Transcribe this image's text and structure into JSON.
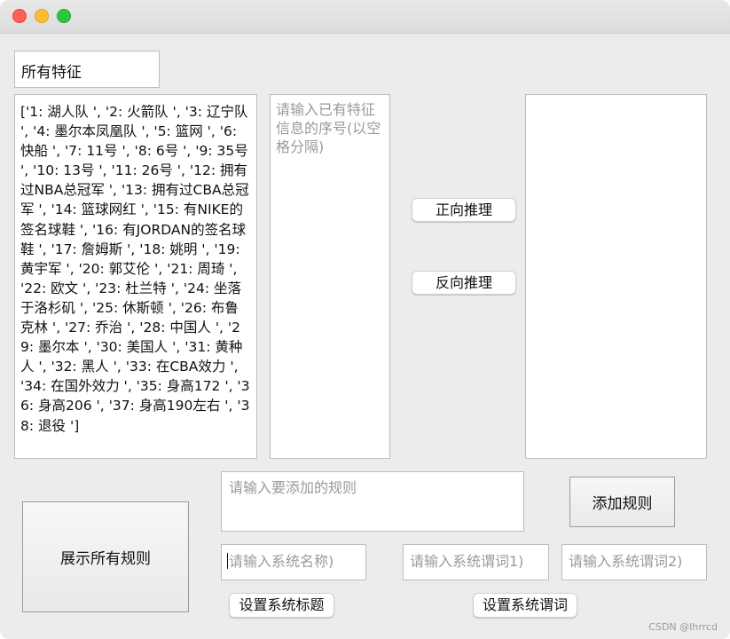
{
  "window": {
    "controls": {
      "close_color": "#ff5f57",
      "minimize_color": "#febc2e",
      "zoom_color": "#28c840"
    }
  },
  "feature_label": "所有特征",
  "features_text": "['1: 湖人队 ', '2: 火箭队 ', '3: 辽宁队 ', '4: 墨尔本凤凰队 ', '5: 篮网 ', '6: 快船 ', '7: 11号 ', '8: 6号 ', '9: 35号 ', '10: 13号 ', '11: 26号 ', '12: 拥有过NBA总冠军 ', '13: 拥有过CBA总冠军 ', '14: 篮球网红 ', '15: 有NIKE的签名球鞋 ', '16: 有JORDAN的签名球鞋 ', '17: 詹姆斯 ', '18: 姚明 ', '19: 黄宇军 ', '20: 郭艾伦 ', '21: 周琦 ', '22: 欧文 ', '23: 杜兰特 ', '24: 坐落于洛杉矶 ', '25: 休斯顿 ', '26: 布鲁克林 ', '27: 乔治 ', '28: 中国人 ', '29: 墨尔本 ', '30: 美国人 ', '31: 黄种人 ', '32: 黑人 ', '33: 在CBA效力 ', '34: 在国外效力 ', '35: 身高172 ', '36: 身高206 ', '37: 身高190左右 ', '38: 退役 ']",
  "sequence_input": {
    "placeholder": "请输入已有特征信息的序号(以空格分隔)",
    "value": ""
  },
  "result_output": {
    "value": ""
  },
  "buttons": {
    "forward": "正向推理",
    "backward": "反向推理",
    "add_rule": "添加规则",
    "show_all": "展示所有规则",
    "set_title": "设置系统标题",
    "set_predicate": "设置系统谓词"
  },
  "rule_input": {
    "placeholder": "请输入要添加的规则",
    "value": ""
  },
  "system_name_input": {
    "placeholder": "请输入系统名称)",
    "value": ""
  },
  "predicate1_input": {
    "placeholder": "请输入系统谓词1)",
    "value": ""
  },
  "predicate2_input": {
    "placeholder": "请输入系统谓词2)",
    "value": ""
  },
  "watermark": "CSDN @Ihrrcd"
}
